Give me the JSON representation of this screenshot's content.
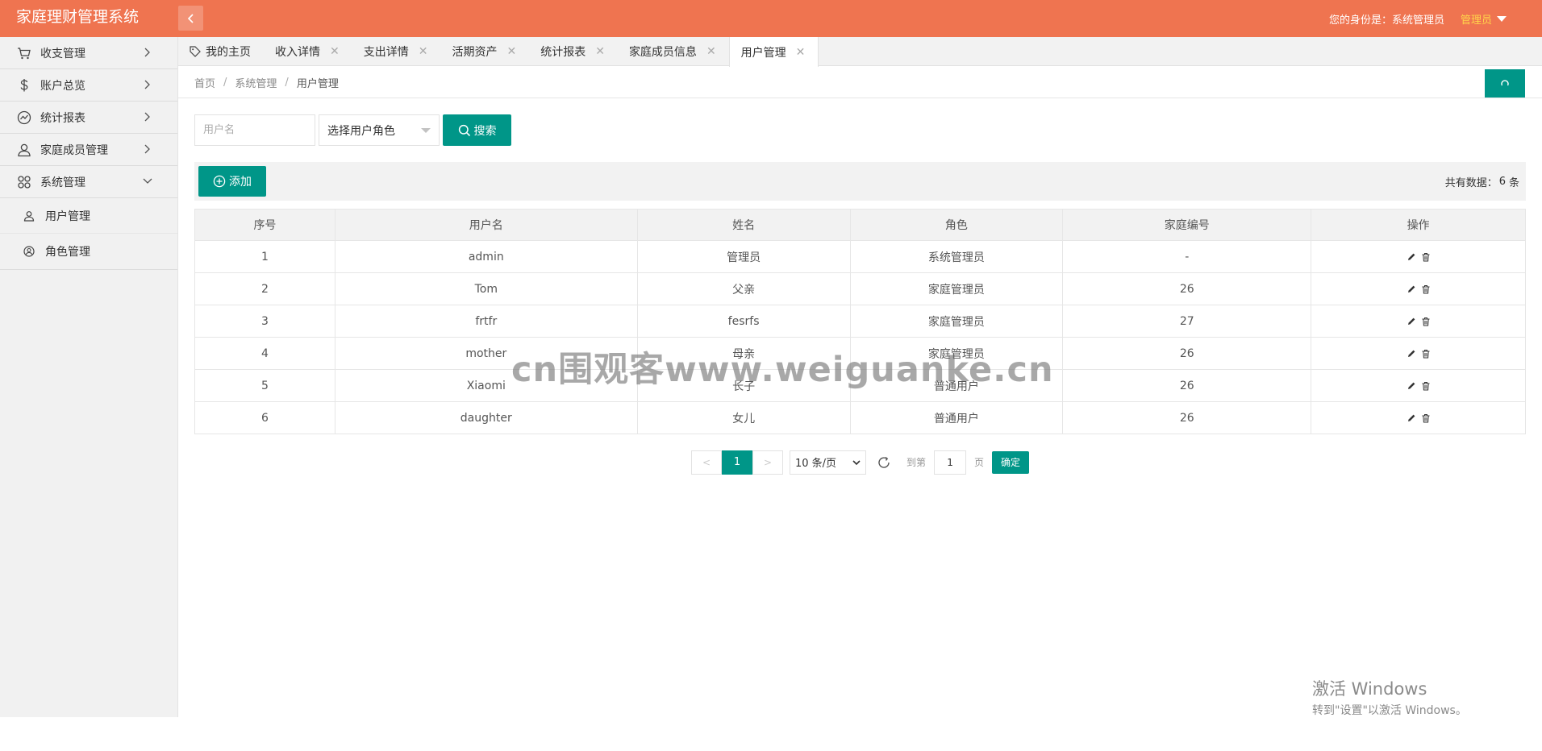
{
  "app": {
    "title": "家庭理财管理系统"
  },
  "header": {
    "identity_label": "您的身份是：系统管理员",
    "user_name": "管理员"
  },
  "sidebar": {
    "items": [
      {
        "label": "收支管理",
        "icon": "cart-icon"
      },
      {
        "label": "账户总览",
        "icon": "dollar-icon"
      },
      {
        "label": "统计报表",
        "icon": "chart-icon"
      },
      {
        "label": "家庭成员管理",
        "icon": "users-icon"
      },
      {
        "label": "系统管理",
        "icon": "apps-icon",
        "expanded": true
      }
    ],
    "sub_items": [
      {
        "label": "用户管理",
        "icon": "user-icon"
      },
      {
        "label": "角色管理",
        "icon": "role-icon"
      }
    ]
  },
  "tabs": [
    {
      "label": "我的主页"
    },
    {
      "label": "收入详情"
    },
    {
      "label": "支出详情"
    },
    {
      "label": "活期资产"
    },
    {
      "label": "统计报表"
    },
    {
      "label": "家庭成员信息"
    },
    {
      "label": "用户管理",
      "active": true
    }
  ],
  "breadcrumb": [
    "首页",
    "系统管理",
    "用户管理"
  ],
  "search": {
    "username_placeholder": "用户名",
    "role_select_label": "选择用户角色",
    "search_label": "搜索"
  },
  "toolbar": {
    "add_label": "添加",
    "total_prefix": "共有数据：",
    "total_count": "6",
    "total_suffix": "条"
  },
  "table": {
    "columns": [
      "序号",
      "用户名",
      "姓名",
      "角色",
      "家庭编号",
      "操作"
    ],
    "rows": [
      [
        "1",
        "admin",
        "管理员",
        "系统管理员",
        "-"
      ],
      [
        "2",
        "Tom",
        "父亲",
        "家庭管理员",
        "26"
      ],
      [
        "3",
        "frtfr",
        "fesrfs",
        "家庭管理员",
        "27"
      ],
      [
        "4",
        "mother",
        "母亲",
        "家庭管理员",
        "26"
      ],
      [
        "5",
        "Xiaomi",
        "长子",
        "普通用户",
        "26"
      ],
      [
        "6",
        "daughter",
        "女儿",
        "普通用户",
        "26"
      ]
    ]
  },
  "pagination": {
    "prev": "<",
    "current": "1",
    "next": ">",
    "page_size": "10 条/页",
    "goto_label": "到第",
    "goto_value": "1",
    "page_label": "页",
    "confirm_label": "确定"
  },
  "watermark": "cn围观客www.weiguanke.cn",
  "windows_notice": {
    "title": "激活 Windows",
    "subtitle": "转到\"设置\"以激活 Windows。"
  },
  "colors": {
    "header_bg": "#ef7450",
    "accent": "#009688",
    "sidebar_bg": "#f1f1f1",
    "username_highlight": "#ffd54a"
  }
}
